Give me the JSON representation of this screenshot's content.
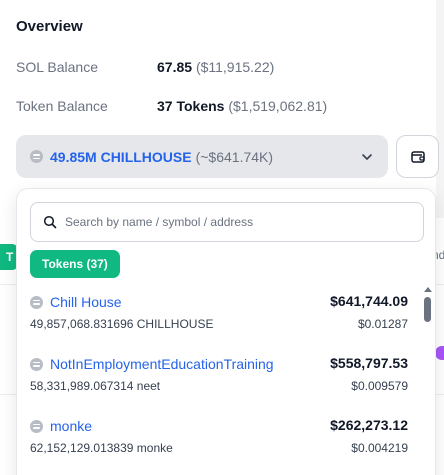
{
  "overview": {
    "title": "Overview",
    "sol_label": "SOL Balance",
    "sol_value": "67.85",
    "sol_usd": "($11,915.22)",
    "token_label": "Token Balance",
    "token_value": "37 Tokens",
    "token_usd": "($1,519,062.81)"
  },
  "selector": {
    "selected_name": "49.85M CHILLHOUSE",
    "selected_usd": "(~$641.74K)",
    "chevron_icon": "chevron-down-icon",
    "wallet_icon": "wallet-icon"
  },
  "background": {
    "left_tab": "T",
    "right_tab": "nd"
  },
  "dropdown": {
    "search_placeholder": "Search by name / symbol / address",
    "search_value": "",
    "filter_tab": "Tokens (37)",
    "accent_color": "#10b981",
    "link_color": "#2563eb",
    "tokens": [
      {
        "name": "Chill House",
        "amount": "49,857,068.831696 CHILLHOUSE",
        "usd": "$641,744.09",
        "price": "$0.01287"
      },
      {
        "name": "NotInEmploymentEducationTraining",
        "amount": "58,331,989.067314 neet",
        "usd": "$558,797.53",
        "price": "$0.009579"
      },
      {
        "name": "monke",
        "amount": "62,152,129.013839 monke",
        "usd": "$262,273.12",
        "price": "$0.004219"
      }
    ]
  }
}
